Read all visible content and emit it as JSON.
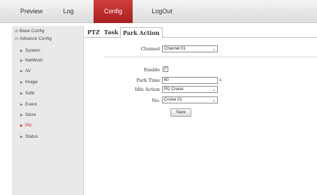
{
  "topnav": {
    "preview": "Preview",
    "log": "Log",
    "config": "Config",
    "logout": "LogOut"
  },
  "sidebar": {
    "base_config": "Base Config",
    "advance_config": "Advance Config",
    "items": [
      {
        "label": "System"
      },
      {
        "label": "NetWork"
      },
      {
        "label": "AV"
      },
      {
        "label": "Image"
      },
      {
        "label": "Safe"
      },
      {
        "label": "Event"
      },
      {
        "label": "Store"
      },
      {
        "label": "Ptz"
      },
      {
        "label": "Status"
      }
    ],
    "active_item": "Ptz"
  },
  "tabs": [
    {
      "label": "PTZ"
    },
    {
      "label": "Task"
    },
    {
      "label": "Park Action"
    }
  ],
  "active_tab": "Park Action",
  "form": {
    "channel_label": "Channel",
    "channel_value": "Channel 01",
    "enable_label": "Enable",
    "enable_checked": true,
    "park_time_label": "Park Time",
    "park_time_value": "60",
    "park_time_unit": "s",
    "idle_action_label": "Idle Action",
    "idle_action_value": "Ptz Cruise",
    "no_label": "No.",
    "no_value": "Cruise 01",
    "save_label": "Save"
  },
  "colors": {
    "accent": "#b52727",
    "active_text": "#c62828"
  }
}
